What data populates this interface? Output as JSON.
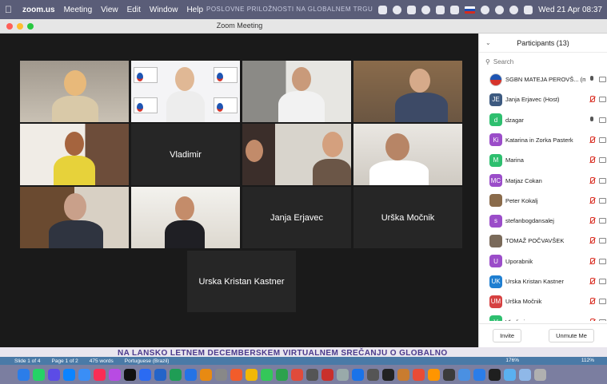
{
  "menubar": {
    "app": "zoom.us",
    "items": [
      "Meeting",
      "View",
      "Edit",
      "Window",
      "Help"
    ],
    "doc_title": "POSLOVNE PRILOŽNOSTI NA GLOBALNEM TRGU",
    "clock": "Wed 21 Apr 08:37"
  },
  "window": {
    "title": "Zoom Meeting"
  },
  "video_tiles": [
    {
      "name": "",
      "kind": "camera",
      "active": true
    },
    {
      "name": "",
      "kind": "camera"
    },
    {
      "name": "",
      "kind": "camera"
    },
    {
      "name": "",
      "kind": "camera"
    },
    {
      "name": "",
      "kind": "camera"
    },
    {
      "name": "Vladimir",
      "kind": "name"
    },
    {
      "name": "",
      "kind": "camera"
    },
    {
      "name": "",
      "kind": "camera"
    },
    {
      "name": "",
      "kind": "camera"
    },
    {
      "name": "",
      "kind": "camera"
    },
    {
      "name": "Janja Erjavec",
      "kind": "name"
    },
    {
      "name": "Urška Močnik",
      "kind": "name"
    },
    {
      "name": "Urska Kristan Kastner",
      "kind": "name"
    }
  ],
  "participants": {
    "title": "Participants (13)",
    "search_placeholder": "Search",
    "list": [
      {
        "name": "SGBN MATEJA PEROVŠ... (me)",
        "initials": "",
        "color": "#ffffff",
        "mic": "on"
      },
      {
        "name": "Janja Erjavec (Host)",
        "initials": "JE",
        "color": "#3d5a80",
        "mic": "off"
      },
      {
        "name": "dzagar",
        "initials": "d",
        "color": "#2ebf6f",
        "mic": "on"
      },
      {
        "name": "Katarina in Zorka Pasterk",
        "initials": "Ki",
        "color": "#9b4dc9",
        "mic": "off"
      },
      {
        "name": "Marina",
        "initials": "M",
        "color": "#2ebf6f",
        "mic": "off"
      },
      {
        "name": "Matjaz Cokan",
        "initials": "MC",
        "color": "#9b4dc9",
        "mic": "off"
      },
      {
        "name": "Peter Kokalj",
        "initials": "",
        "color": "#8a6b4b",
        "mic": "off"
      },
      {
        "name": "stefanbogdansalej",
        "initials": "s",
        "color": "#9b4dc9",
        "mic": "off"
      },
      {
        "name": "TOMAŽ POČVAVŠEK",
        "initials": "",
        "color": "#7a6a5a",
        "mic": "off"
      },
      {
        "name": "Uporabnik",
        "initials": "U",
        "color": "#9b4dc9",
        "mic": "off"
      },
      {
        "name": "Urska Kristan Kastner",
        "initials": "UK",
        "color": "#1f7fd1",
        "mic": "off"
      },
      {
        "name": "Urška Močnik",
        "initials": "UM",
        "color": "#d64141",
        "mic": "off"
      },
      {
        "name": "Vladimir",
        "initials": "V",
        "color": "#2ebf6f",
        "mic": "off"
      }
    ],
    "invite_label": "Invite",
    "unmute_label": "Unmute Me"
  },
  "background_doc": {
    "heading": "NA LANSKO LETNEM DECEMBERSKEM VIRTUALNEM SREČANJU O GLOBALNO",
    "slide": "Slide 1 of 4",
    "page": "Page 1 of 2",
    "words": "475 words",
    "lang": "Portuguese (Brazil)",
    "zoom_a": "176%",
    "zoom_b": "112%"
  },
  "colors": {
    "active_speaker": "#c8d83a",
    "mic_muted": "#d93025",
    "menubar": "#5a5d78"
  }
}
